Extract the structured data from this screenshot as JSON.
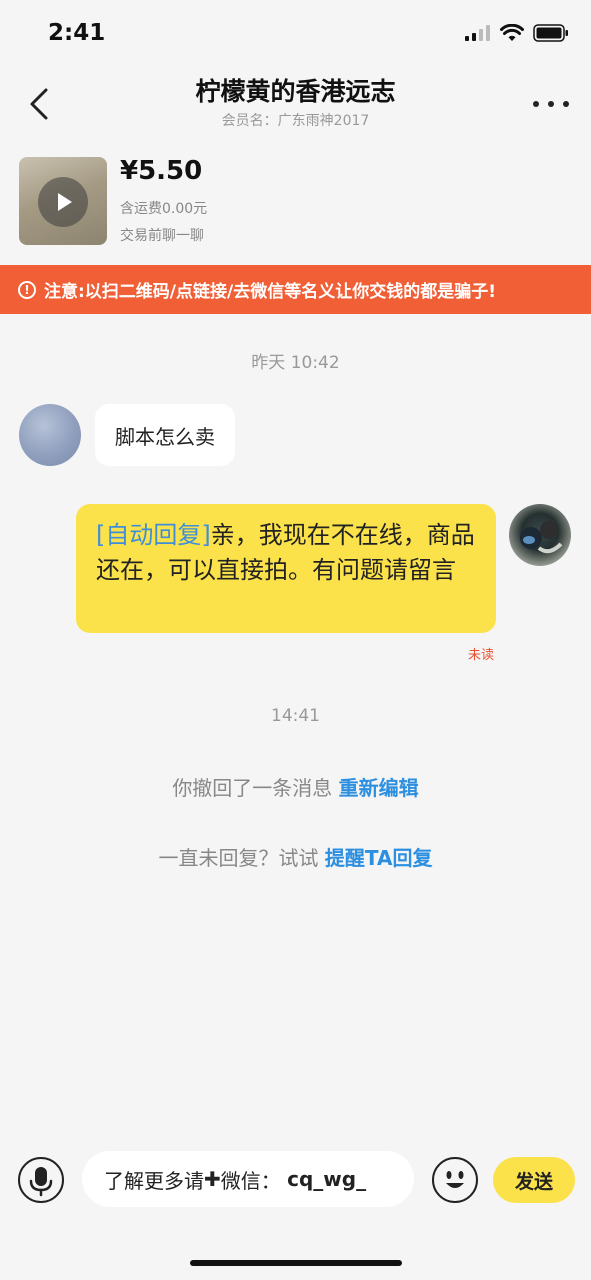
{
  "status_bar": {
    "time": "2:41"
  },
  "header": {
    "title": "柠檬黄的香港远志",
    "subtitle": "会员名：广东雨神2017"
  },
  "product": {
    "price": "¥5.50",
    "shipping": "含运费0.00元",
    "note": "交易前聊一聊"
  },
  "warning": {
    "text": "注意:以扫二维码/点链接/去微信等名义让你交钱的都是骗子!"
  },
  "chat": {
    "timestamp_1": "昨天 10:42",
    "msg_incoming": "脚本怎么卖",
    "msg_outgoing_tag": "[自动回复]",
    "msg_outgoing_text": "亲，我现在不在线，商品还在，可以直接拍。有问题请留言",
    "unread_label": "未读",
    "timestamp_2": "14:41",
    "recall_text": "你撤回了一条消息",
    "recall_link": "重新编辑",
    "reminder_text": "一直未回复？试试",
    "reminder_link": "提醒TA回复"
  },
  "input_bar": {
    "prefix": "了解更多请",
    "plus": "✚",
    "mid": "微信：",
    "value": "cq_wg_",
    "send_label": "发送"
  },
  "colors": {
    "accent_yellow": "#fbe24a",
    "warning_orange": "#f05f35",
    "link_blue": "#2d8fe0",
    "unread_red": "#e8522f"
  },
  "icons": [
    "back-icon",
    "more-icon",
    "play-icon",
    "alert-icon",
    "microphone-icon",
    "emoji-icon",
    "wifi-icon",
    "battery-icon",
    "signal-icon"
  ]
}
